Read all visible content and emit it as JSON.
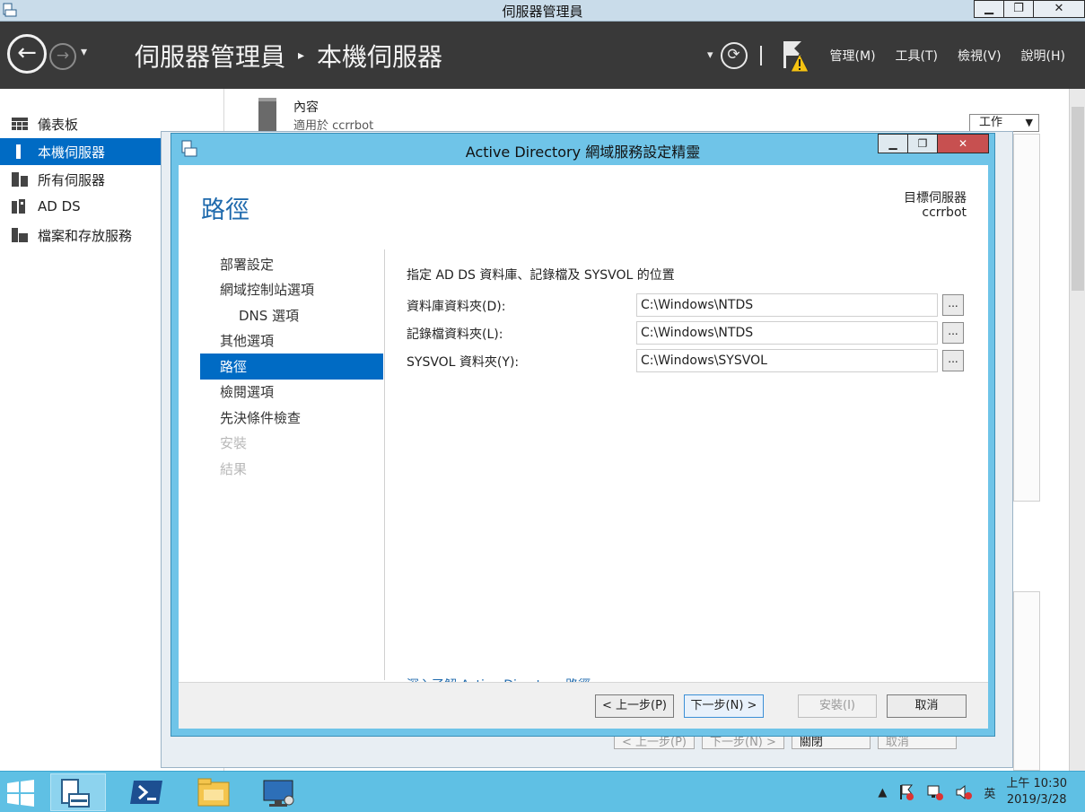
{
  "window": {
    "title": "伺服器管理員",
    "min": "▁",
    "max": "❐",
    "close": "✕"
  },
  "header": {
    "back_glyph": "←",
    "forward_glyph": "→",
    "dropdown_glyph": "▾",
    "crumb_root": "伺服器管理員",
    "crumb_sep": "▸",
    "crumb_current": "本機伺服器",
    "refresh_glyph": "⟳",
    "menus": [
      "管理(M)",
      "工具(T)",
      "檢視(V)",
      "說明(H)"
    ]
  },
  "sidebar": {
    "items": [
      {
        "label": "儀表板",
        "icon": "dashboard-icon"
      },
      {
        "label": "本機伺服器",
        "icon": "server-icon"
      },
      {
        "label": "所有伺服器",
        "icon": "servers-icon"
      },
      {
        "label": "AD DS",
        "icon": "ad-ds-icon"
      },
      {
        "label": "檔案和存放服務",
        "icon": "file-storage-icon"
      }
    ]
  },
  "background": {
    "props_title": "內容",
    "props_sub": "適用於 ccrrbot",
    "work_label": "工作",
    "behind_buttons": [
      "< 上一步(P)",
      "下一步(N) >",
      "關閉",
      "取消"
    ]
  },
  "dialog": {
    "title": "Active Directory 網域服務設定精靈",
    "heading": "路徑",
    "target_label": "目標伺服器",
    "target_value": "ccrrbot",
    "steps": [
      {
        "label": "部署設定",
        "state": "normal",
        "indent": false
      },
      {
        "label": "網域控制站選項",
        "state": "normal",
        "indent": false
      },
      {
        "label": "DNS 選項",
        "state": "normal",
        "indent": true
      },
      {
        "label": "其他選項",
        "state": "normal",
        "indent": false
      },
      {
        "label": "路徑",
        "state": "active",
        "indent": false
      },
      {
        "label": "檢閱選項",
        "state": "normal",
        "indent": false
      },
      {
        "label": "先決條件檢查",
        "state": "normal",
        "indent": false
      },
      {
        "label": "安裝",
        "state": "disabled",
        "indent": false
      },
      {
        "label": "結果",
        "state": "disabled",
        "indent": false
      }
    ],
    "instruction": "指定 AD DS 資料庫、記錄檔及 SYSVOL 的位置",
    "fields": [
      {
        "label": "資料庫資料夾(D):",
        "value": "C:\\Windows\\NTDS"
      },
      {
        "label": "記錄檔資料夾(L):",
        "value": "C:\\Windows\\NTDS"
      },
      {
        "label": "SYSVOL 資料夾(Y):",
        "value": "C:\\Windows\\SYSVOL"
      }
    ],
    "browse_label": "...",
    "learn_more": "深入了解 Active Directory 路徑",
    "buttons": {
      "prev": "< 上一步(P)",
      "next": "下一步(N) >",
      "install": "安裝(I)",
      "cancel": "取消"
    }
  },
  "taskbar": {
    "clock_time": "上午 10:30",
    "clock_date": "2019/3/28",
    "ime": "英",
    "tray_arrow": "▲"
  },
  "colors": {
    "accent": "#006bc4",
    "dialog_frame": "#6fc4e8",
    "header_bg": "#393939",
    "taskbar": "#5fc0e4"
  }
}
